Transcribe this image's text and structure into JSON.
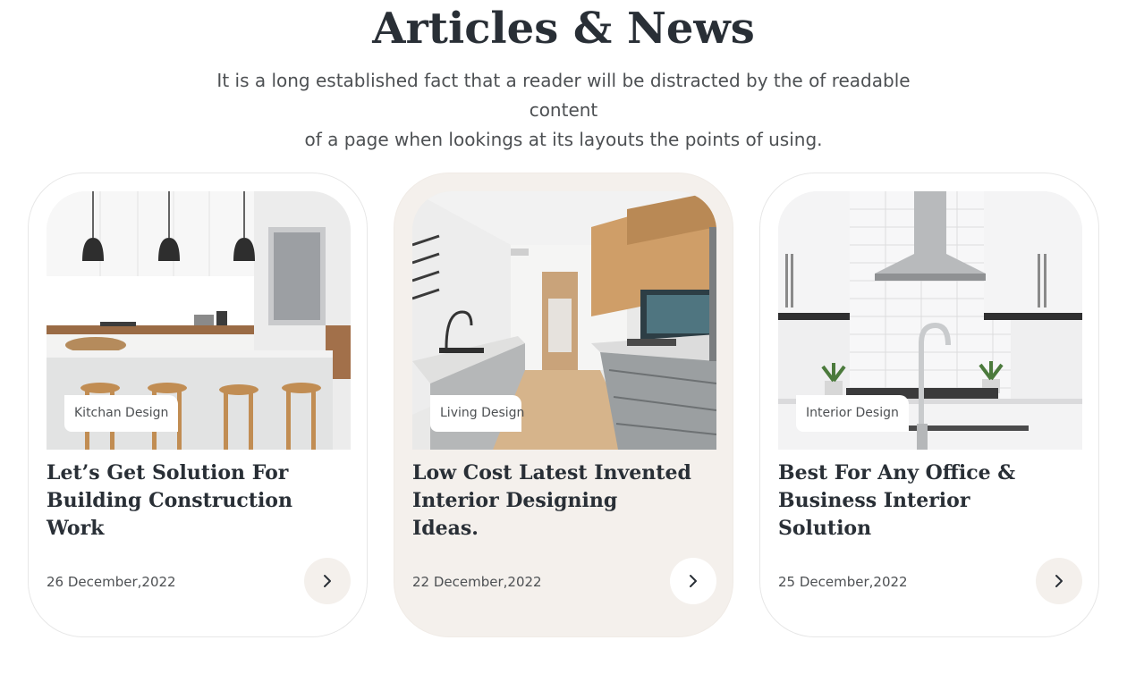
{
  "section": {
    "title": "Articles & News",
    "description_line1": "It is a long established fact that a reader will be distracted by the of readable content",
    "description_line2": "of a page when lookings at its layouts the points of using."
  },
  "colors": {
    "heading": "#292f36",
    "body_text": "#4d5053",
    "active_card_bg": "#f4f0ec",
    "card_border": "#e7e7e7",
    "button_bg": "#f4f0ec"
  },
  "articles": [
    {
      "tag": "Kitchan Design",
      "title": "Let’s Get Solution For\nBuilding Construction\nWork",
      "date": "26 December,2022",
      "image": "kitchen-with-pendant-lights-and-stools",
      "button_icon": "chevron-right-icon",
      "active": false
    },
    {
      "tag": "Living Design",
      "title": "Low Cost Latest Invented\nInterior Designing\nIdeas.",
      "date": "22 December,2022",
      "image": "galley-kitchen-with-wood-cabinets",
      "button_icon": "chevron-right-icon",
      "active": true
    },
    {
      "tag": "Interior Design",
      "title": "Best For Any Office &\nBusiness Interior\nSolution",
      "date": "25 December,2022",
      "image": "white-kitchen-with-steel-range-hood",
      "button_icon": "chevron-right-icon",
      "active": false
    }
  ]
}
